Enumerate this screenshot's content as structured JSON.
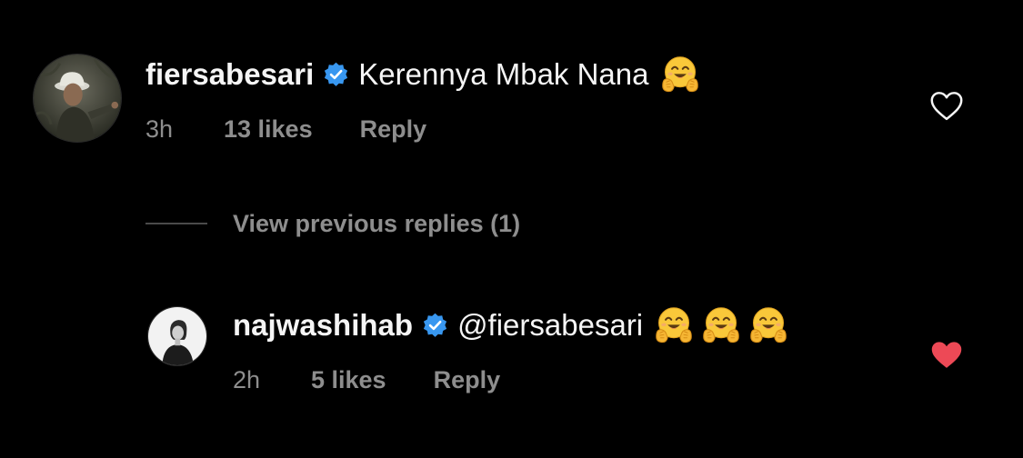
{
  "comments": [
    {
      "username": "fiersabesari",
      "text": "Kerennya Mbak Nana",
      "emoji_count": 1,
      "emoji": "hugging-face-icon",
      "time": "3h",
      "likes": "13 likes",
      "reply_label": "Reply",
      "liked": false
    },
    {
      "username": "najwashihab",
      "text": "@fiersabesari",
      "emoji_count": 3,
      "emoji": "hugging-face-icon",
      "time": "2h",
      "likes": "5 likes",
      "reply_label": "Reply",
      "liked": true
    }
  ],
  "view_previous": {
    "label": "View previous replies (1)"
  },
  "colors": {
    "background": "#000000",
    "text": "#f5f5f5",
    "muted": "#8e8e8e",
    "verified": "#3897f0",
    "heart_liked": "#ed4956"
  }
}
